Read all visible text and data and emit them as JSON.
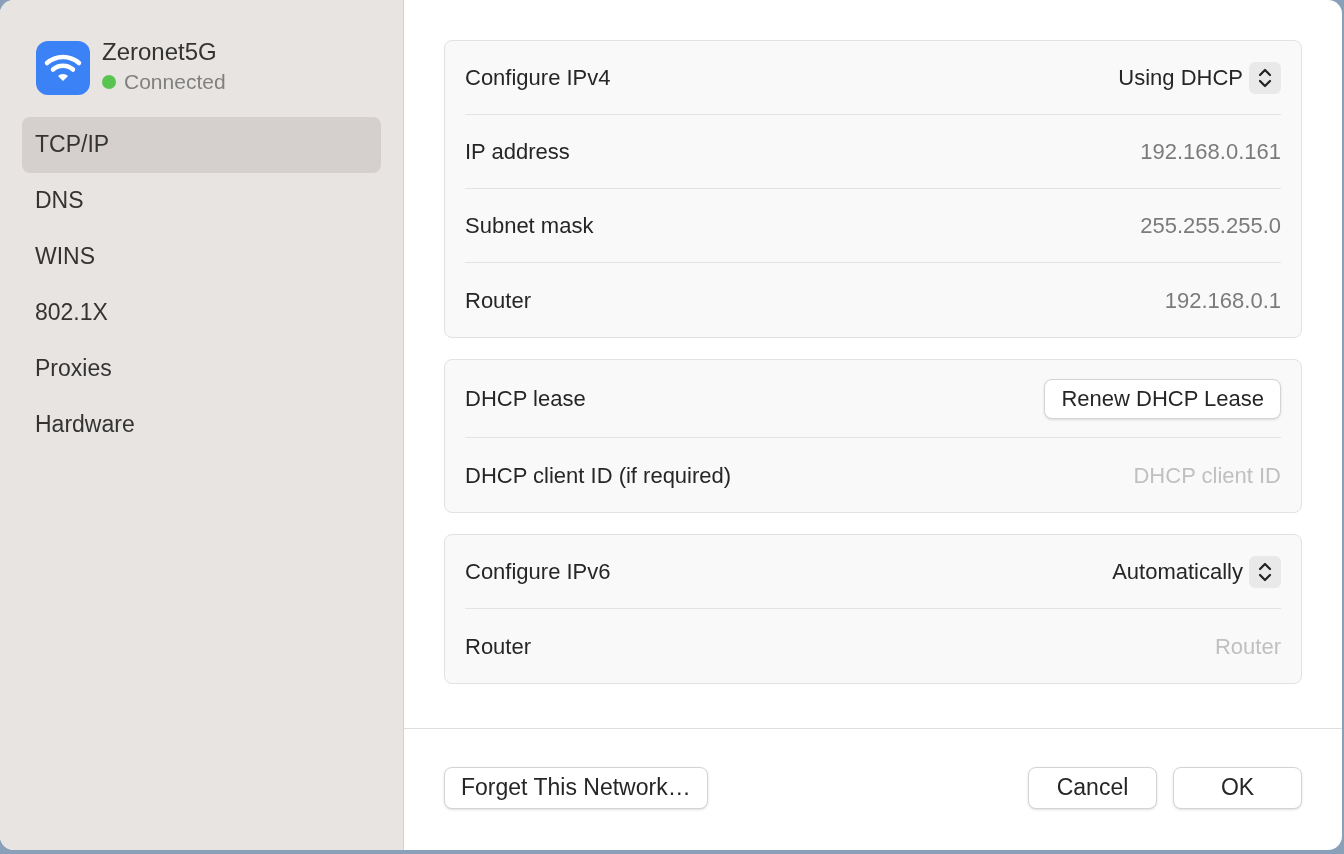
{
  "network": {
    "name": "Zeronet5G",
    "status": "Connected",
    "connected": true
  },
  "sidebar": {
    "items": [
      {
        "label": "TCP/IP",
        "selected": true
      },
      {
        "label": "DNS",
        "selected": false
      },
      {
        "label": "WINS",
        "selected": false
      },
      {
        "label": "802.1X",
        "selected": false
      },
      {
        "label": "Proxies",
        "selected": false
      },
      {
        "label": "Hardware",
        "selected": false
      }
    ]
  },
  "groups": [
    {
      "rows": [
        {
          "kind": "select",
          "label": "Configure IPv4",
          "value": "Using DHCP"
        },
        {
          "kind": "value",
          "label": "IP address",
          "value": "192.168.0.161"
        },
        {
          "kind": "value",
          "label": "Subnet mask",
          "value": "255.255.255.0"
        },
        {
          "kind": "value",
          "label": "Router",
          "value": "192.168.0.1"
        }
      ]
    },
    {
      "rows": [
        {
          "kind": "button",
          "label": "DHCP lease",
          "value": "Renew DHCP Lease"
        },
        {
          "kind": "field",
          "label": "DHCP client ID (if required)",
          "placeholder": "DHCP client ID"
        }
      ]
    },
    {
      "rows": [
        {
          "kind": "select",
          "label": "Configure IPv6",
          "value": "Automatically"
        },
        {
          "kind": "field",
          "label": "Router",
          "placeholder": "Router"
        }
      ]
    }
  ],
  "footer": {
    "left_button": "Forget This Network…",
    "buttons": [
      "Cancel",
      "OK"
    ]
  }
}
